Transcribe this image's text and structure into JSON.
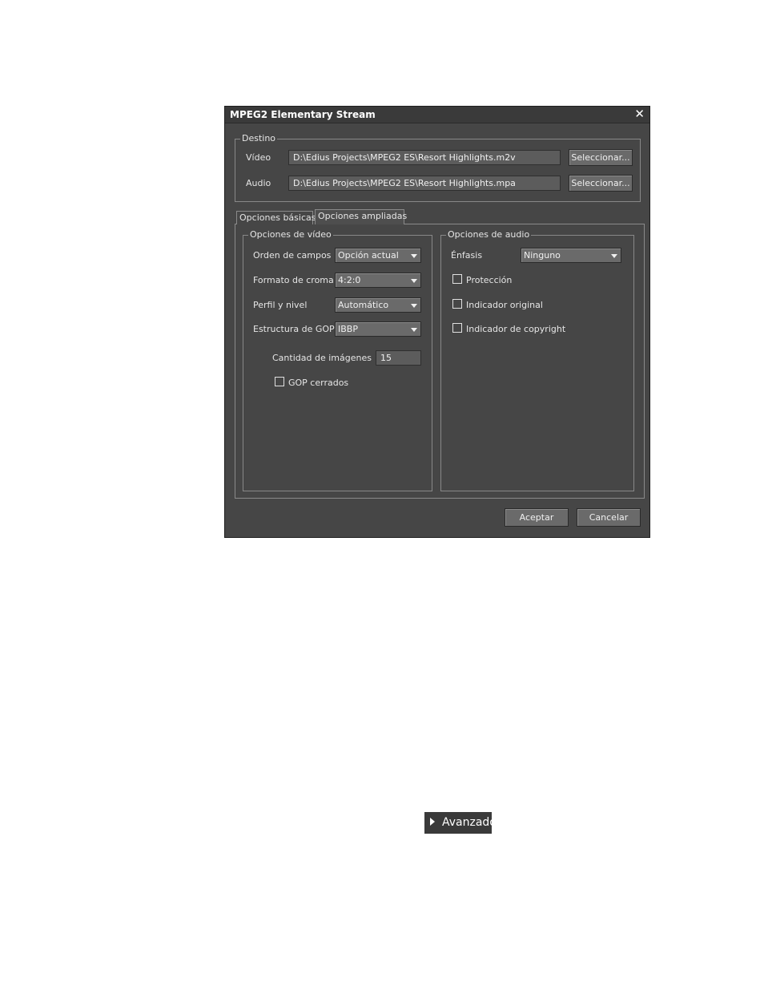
{
  "dialog": {
    "title": "MPEG2 Elementary Stream",
    "close_glyph": "✕",
    "destino": {
      "label": "Destino",
      "video_label": "Vídeo",
      "video_path": "D:\\Edius Projects\\MPEG2 ES\\Resort Highlights.m2v",
      "audio_label": "Audio",
      "audio_path": "D:\\Edius Projects\\MPEG2 ES\\Resort Highlights.mpa",
      "select_label": "Seleccionar..."
    },
    "tabs": [
      {
        "label": "Opciones básicas",
        "active": false
      },
      {
        "label": "Opciones ampliadas",
        "active": true
      }
    ],
    "video_options": {
      "label": "Opciones de vídeo",
      "field_order_label": "Orden de campos",
      "field_order_value": "Opción actual",
      "chroma_label": "Formato de croma",
      "chroma_value": "4:2:0",
      "profile_label": "Perfil y nivel",
      "profile_value": "Automático",
      "gop_label": "Estructura de GOP",
      "gop_value": "IBBP",
      "frames_label": "Cantidad de imágenes",
      "frames_value": "15",
      "closed_gop_label": "GOP cerrados",
      "closed_gop_checked": false
    },
    "audio_options": {
      "label": "Opciones de audio",
      "emphasis_label": "Énfasis",
      "emphasis_value": "Ninguno",
      "protection_label": "Protección",
      "protection_checked": false,
      "original_label": "Indicador original",
      "original_checked": false,
      "copyright_label": "Indicador de copyright",
      "copyright_checked": false
    },
    "ok_label": "Aceptar",
    "cancel_label": "Cancelar"
  },
  "advanced_button": {
    "label": "Avanzado"
  },
  "icons": {
    "close": "close-icon",
    "dropdown": "chevron-down-icon",
    "expand": "triangle-right-icon"
  }
}
